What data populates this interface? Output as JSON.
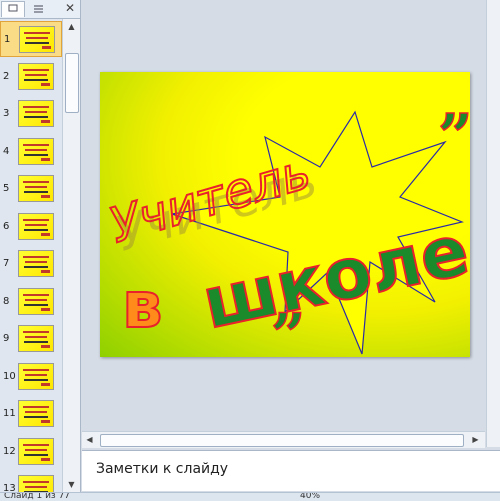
{
  "slides_panel": {
    "tabs": [
      "slides-tab",
      "outline-tab"
    ],
    "close_icon": "close-icon",
    "thumbnails": [
      {
        "number": "1",
        "selected": true
      },
      {
        "number": "2",
        "selected": false
      },
      {
        "number": "3",
        "selected": false
      },
      {
        "number": "4",
        "selected": false
      },
      {
        "number": "5",
        "selected": false
      },
      {
        "number": "6",
        "selected": false
      },
      {
        "number": "7",
        "selected": false
      },
      {
        "number": "8",
        "selected": false
      },
      {
        "number": "9",
        "selected": false
      },
      {
        "number": "10",
        "selected": false
      },
      {
        "number": "11",
        "selected": false
      },
      {
        "number": "12",
        "selected": false
      },
      {
        "number": "13",
        "selected": false
      }
    ]
  },
  "slide": {
    "word_teacher": "Учитель",
    "word_in": "в",
    "word_school": "школе",
    "quote_open": "„",
    "quote_close": "”",
    "colors": {
      "text_red": "#e8212b",
      "text_green": "#1a8a2a",
      "star_outline": "#2a2aa8",
      "in_orange": "#ff8c1a"
    }
  },
  "notes": {
    "placeholder": "Заметки к слайду"
  },
  "status": {
    "slide_info": "Слайд 1 из 77",
    "zoom": "40%"
  }
}
